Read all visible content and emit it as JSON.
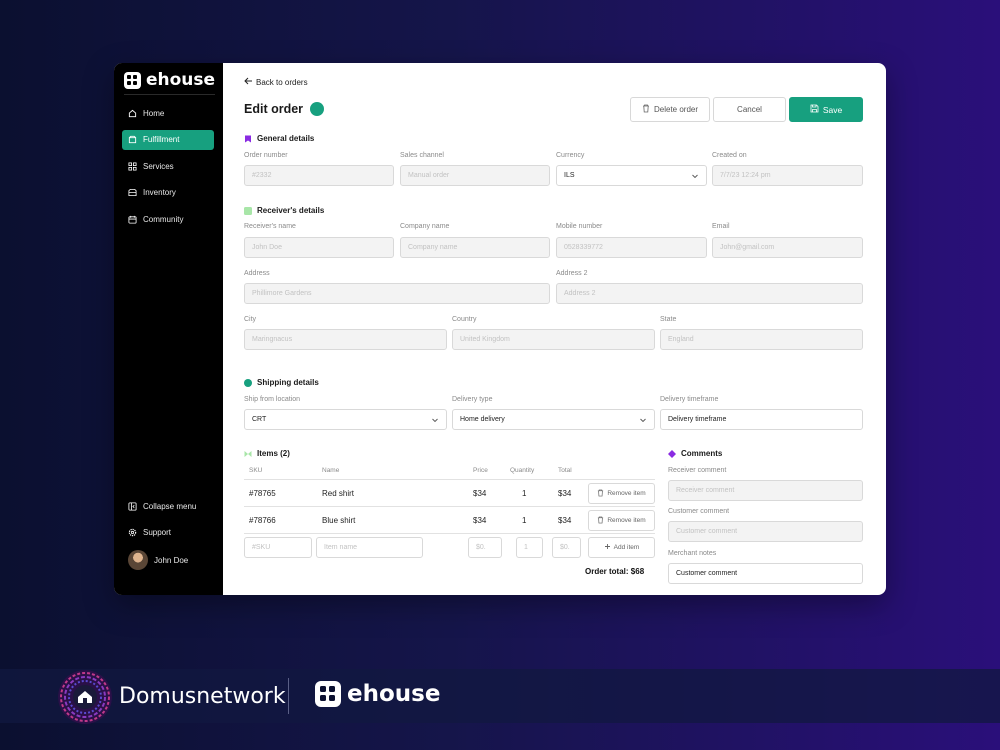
{
  "app": {
    "name": "ehouse"
  },
  "sidebar": {
    "items": [
      {
        "label": "Home",
        "icon": "home-icon"
      },
      {
        "label": "Fulfillment",
        "icon": "box-icon",
        "active": true
      },
      {
        "label": "Services",
        "icon": "grid-icon"
      },
      {
        "label": "Inventory",
        "icon": "archive-icon"
      },
      {
        "label": "Community",
        "icon": "calendar-icon"
      }
    ],
    "collapse_label": "Collapse menu",
    "support_label": "Support",
    "user_name": "John Doe"
  },
  "header": {
    "back_label": "Back to orders",
    "title": "Edit order",
    "delete_label": "Delete order",
    "cancel_label": "Cancel",
    "save_label": "Save"
  },
  "general": {
    "title": "General details",
    "order_number": {
      "label": "Order number",
      "placeholder": "#2332"
    },
    "sales_channel": {
      "label": "Sales channel",
      "placeholder": "Manual order"
    },
    "currency": {
      "label": "Currency",
      "value": "ILS"
    },
    "created_on": {
      "label": "Created on",
      "placeholder": "7/7/23 12:24 pm"
    }
  },
  "receiver": {
    "title": "Receiver's details",
    "name": {
      "label": "Receiver's name",
      "placeholder": "John Doe"
    },
    "company": {
      "label": "Company name",
      "placeholder": "Company name"
    },
    "mobile": {
      "label": "Mobile number",
      "placeholder": "0528339772"
    },
    "email": {
      "label": "Email",
      "placeholder": "John@gmail.com"
    },
    "address": {
      "label": "Address",
      "placeholder": "Phillimore Gardens"
    },
    "address2": {
      "label": "Address 2",
      "placeholder": "Address 2"
    },
    "city": {
      "label": "City",
      "placeholder": "Maringnacus"
    },
    "country": {
      "label": "Country",
      "placeholder": "United Kingdom"
    },
    "state": {
      "label": "State",
      "placeholder": "England"
    }
  },
  "shipping": {
    "title": "Shipping details",
    "from": {
      "label": "Ship from location",
      "value": "CRT"
    },
    "type": {
      "label": "Delivery type",
      "value": "Home delivery"
    },
    "timeframe": {
      "label": "Delivery timeframe",
      "value": "Delivery timeframe"
    }
  },
  "items": {
    "title": "Items (2)",
    "columns": [
      "SKU",
      "Name",
      "Price",
      "Quantity",
      "Total"
    ],
    "rows": [
      {
        "sku": "#78765",
        "name": "Red shirt",
        "price": "$34",
        "qty": "1",
        "total": "$34",
        "action": "Remove item"
      },
      {
        "sku": "#78766",
        "name": "Blue shirt",
        "price": "$34",
        "qty": "1",
        "total": "$34",
        "action": "Remove item"
      }
    ],
    "new_row": {
      "sku": "#SKU",
      "name": "Item name",
      "price": "$0.",
      "qty": "1",
      "total": "$0.",
      "action": "Add item"
    },
    "total_label": "Order total:",
    "total_value": "$68"
  },
  "comments": {
    "title": "Comments",
    "receiver": {
      "label": "Receiver comment",
      "placeholder": "Receiver comment"
    },
    "customer": {
      "label": "Customer comment",
      "placeholder": "Customer comment"
    },
    "merchant": {
      "label": "Merchant notes",
      "value": "Customer comment"
    }
  },
  "footer": {
    "brand1": "Domusnetwork",
    "brand2": "ehouse"
  },
  "colors": {
    "accent": "#17a07f",
    "purple": "#8a2be2",
    "light_green": "#a8e6a8"
  }
}
